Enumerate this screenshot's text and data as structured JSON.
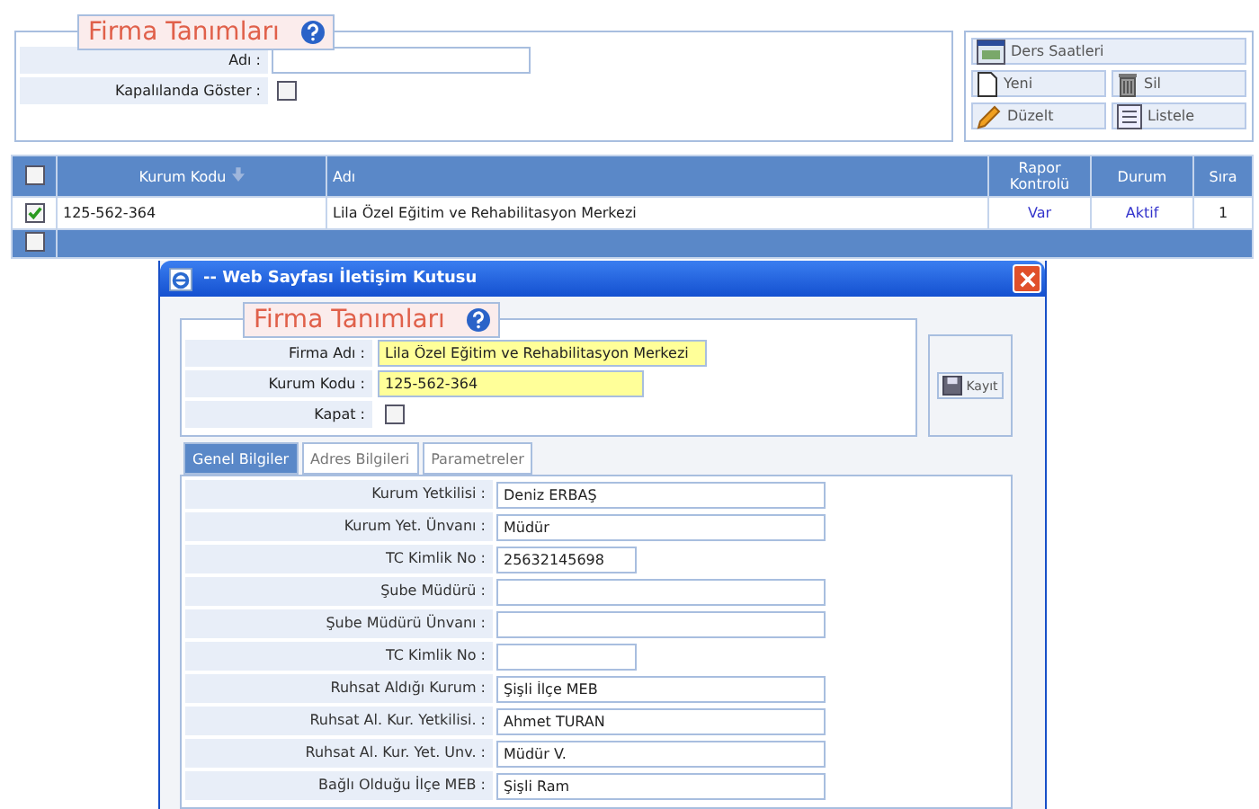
{
  "filter": {
    "title": "Firma Tanımları",
    "fields": [
      {
        "label": "Adı :",
        "kind": "text"
      },
      {
        "label": "Kapalılanda Göster :",
        "kind": "checkbox",
        "checked": false
      }
    ]
  },
  "actions": [
    {
      "label": "Ders Saatleri",
      "kind": "schedule",
      "wide": true
    },
    {
      "label": "Yeni",
      "kind": "new",
      "wide": false
    },
    {
      "label": "Sil",
      "kind": "delete",
      "wide": false
    },
    {
      "label": "Düzelt",
      "kind": "edit",
      "wide": false
    },
    {
      "label": "Listele",
      "kind": "list",
      "wide": false
    }
  ],
  "table": {
    "header_checked": false,
    "columns": [
      {
        "label": "Kurum Kodu",
        "sortable": true
      },
      {
        "label": "Adı",
        "sortable": false
      },
      {
        "label": "Rapor Kontrolü",
        "sortable": false
      },
      {
        "label": "Durum",
        "sortable": false
      },
      {
        "label": "Sıra",
        "sortable": false
      }
    ],
    "rows": [
      {
        "checked": true,
        "cells": [
          "125-562-364",
          "Lila Özel Eğitim ve Rehabilitasyon Merkezi",
          "Var",
          "Aktif",
          "1"
        ]
      }
    ],
    "footer_checked": false
  },
  "dialog": {
    "title": "-- Web Sayfası İletişim Kutusu",
    "form_title": "Firma Tanımları",
    "fields": [
      {
        "label": "Firma Adı :",
        "kind": "long",
        "highlighted": true,
        "value": "Lila Özel Eğitim ve Rehabilitasyon Merkezi"
      },
      {
        "label": "Kurum Kodu :",
        "kind": "medium",
        "highlighted": true,
        "value": "125-562-364"
      },
      {
        "label": "Kapat :",
        "kind": "checkbox",
        "checked": false
      }
    ],
    "save_button": "Kayıt",
    "tabs": [
      {
        "label": "Genel Bilgiler",
        "selected": true
      },
      {
        "label": "Adres Bilgileri",
        "selected": false
      },
      {
        "label": "Parametreler",
        "selected": false
      }
    ],
    "tab_fields": [
      {
        "label": "Kurum Yetkilisi :",
        "kind": "long",
        "value": "Deniz ERBAŞ"
      },
      {
        "label": "Kurum Yet. Ünvanı :",
        "kind": "long",
        "value": "Müdür"
      },
      {
        "label": "TC Kimlik No :",
        "kind": "short",
        "value": "25632145698"
      },
      {
        "label": "Şube Müdürü :",
        "kind": "long"
      },
      {
        "label": "Şube Müdürü Ünvanı :",
        "kind": "long"
      },
      {
        "label": "TC Kimlik No :",
        "kind": "short"
      },
      {
        "label": "Ruhsat Aldığı Kurum :",
        "kind": "long",
        "value": "Şişli İlçe MEB"
      },
      {
        "label": "Ruhsat Al. Kur. Yetkilisi. :",
        "kind": "long",
        "value": "Ahmet TURAN"
      },
      {
        "label": "Ruhsat Al. Kur. Yet. Unv. :",
        "kind": "long",
        "value": "Müdür V."
      },
      {
        "label": "Bağlı Olduğu İlçe MEB :",
        "kind": "long",
        "value": "Şişli Ram"
      }
    ]
  }
}
